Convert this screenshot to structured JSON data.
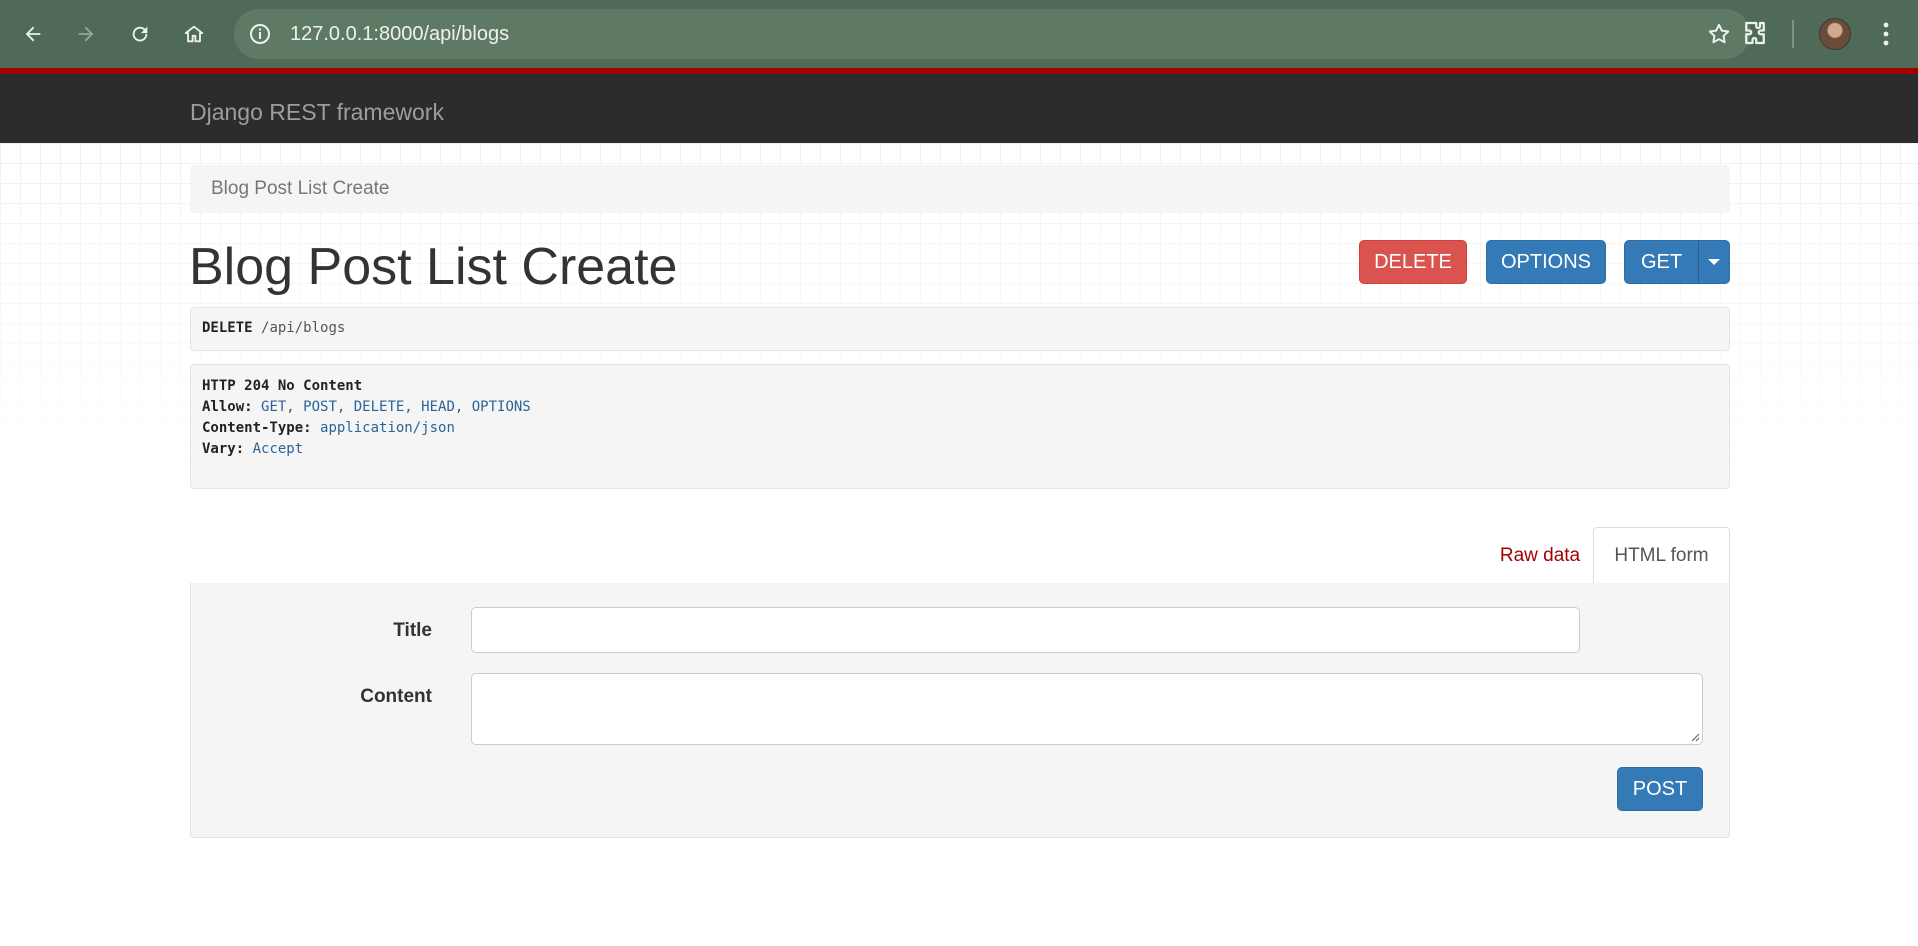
{
  "browser": {
    "url": "127.0.0.1:8000/api/blogs"
  },
  "navbar": {
    "brand": "Django REST framework"
  },
  "breadcrumb": {
    "current": "Blog Post List Create"
  },
  "page": {
    "title": "Blog Post List Create"
  },
  "actions": {
    "delete_label": "DELETE",
    "options_label": "OPTIONS",
    "get_label": "GET"
  },
  "request": {
    "method": "DELETE",
    "path": "/api/blogs"
  },
  "response": {
    "status": "HTTP 204 No Content",
    "headers": [
      {
        "name": "Allow:",
        "value": "GET, POST, DELETE, HEAD, OPTIONS"
      },
      {
        "name": "Content-Type:",
        "value": "application/json"
      },
      {
        "name": "Vary:",
        "value": "Accept"
      }
    ]
  },
  "tabs": {
    "raw": "Raw data",
    "html": "HTML form"
  },
  "form": {
    "title_label": "Title",
    "content_label": "Content",
    "title_value": "",
    "content_value": "",
    "submit_label": "POST"
  },
  "colors": {
    "danger": "#d9534f",
    "primary": "#337ab7",
    "navbar": "#2c2c2c",
    "accent": "#a30000"
  }
}
